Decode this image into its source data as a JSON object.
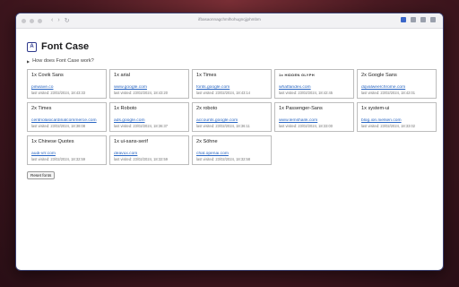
{
  "browser": {
    "url": "ifbasaonnagchmlhohugncjjphmbm"
  },
  "app": {
    "title": "Font Case",
    "faq_label": "How does Font Case work?",
    "reset_label": "Reset fonts"
  },
  "cards": [
    {
      "font": "1x Covik Sans",
      "site": "pinwave.co",
      "visited": "last visited: 23/02/2024, 18:43:33"
    },
    {
      "font": "1x arial",
      "site": "www.google.com",
      "visited": "last visited: 23/02/2024, 18:43:20"
    },
    {
      "font": "1x Times",
      "site": "fonts.google.com",
      "visited": "last visited: 23/02/2024, 18:43:14"
    },
    {
      "font": "1x HIDDEN GLYPH",
      "site": "whatfandex.com",
      "visited": "last visited: 23/02/2024, 18:42:45"
    },
    {
      "font": "2x Google Sans",
      "site": "dqvalweerchrome.com",
      "visited": "last visited: 23/02/2024, 18:42:01"
    },
    {
      "font": "2x Times",
      "site": "centriolasicardinalcommerce.com",
      "visited": "last visited: 23/02/2024, 18:38:08"
    },
    {
      "font": "1x Roboto",
      "site": "ads.google.com",
      "visited": "last visited: 23/02/2024, 18:36:37"
    },
    {
      "font": "2x roboto",
      "site": "accounts.google.com",
      "visited": "last visited: 23/02/2024, 18:36:11"
    },
    {
      "font": "1x Passenger-Sans",
      "site": "www.lemshank.com",
      "visited": "last visited: 23/02/2024, 18:33:00"
    },
    {
      "font": "1x system-ui",
      "site": "blog.ion.nielsen.com",
      "visited": "last visited: 23/02/2024, 18:33:02"
    },
    {
      "font": "1x Chinese Quotes",
      "site": "audi-vrr.com",
      "visited": "last visited: 23/02/2024, 18:32:59"
    },
    {
      "font": "1x ui-sans-serif",
      "site": "deavux.com",
      "visited": "last visited: 23/02/2024, 18:32:59"
    },
    {
      "font": "2x Söhne",
      "site": "chat.openai.com",
      "visited": "last visited: 23/02/2024, 18:32:58"
    }
  ]
}
